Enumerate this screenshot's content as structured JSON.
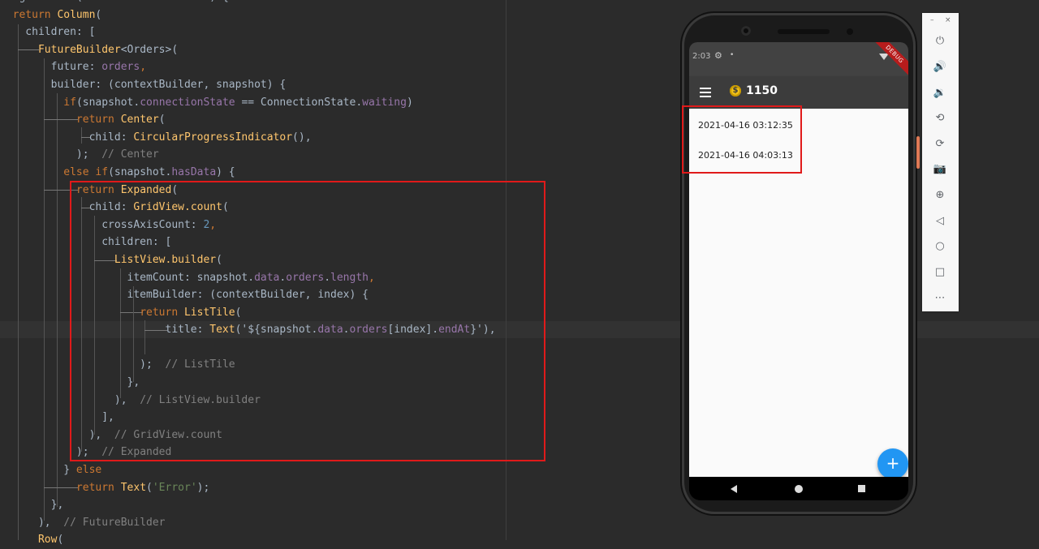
{
  "editor": {
    "lines": [
      [
        {
          "t": "Widget ",
          "c": "plain"
        },
        {
          "t": "build",
          "c": "fn"
        },
        {
          "t": "(BuildContext context) {",
          "c": "plain"
        }
      ],
      [
        {
          "t": "  ",
          "c": "plain"
        },
        {
          "t": "return ",
          "c": "kw"
        },
        {
          "t": "Column",
          "c": "fn"
        },
        {
          "t": "(",
          "c": "plain"
        }
      ],
      [
        {
          "t": "    children: [",
          "c": "plain"
        }
      ],
      [
        {
          "t": "      ",
          "c": "plain"
        },
        {
          "t": "FutureBuilder",
          "c": "fn"
        },
        {
          "t": "<Orders>(",
          "c": "plain"
        }
      ],
      [
        {
          "t": "        future: ",
          "c": "plain"
        },
        {
          "t": "orders",
          "c": "prop"
        },
        {
          "t": ",",
          "c": "kw"
        }
      ],
      [
        {
          "t": "        builder: (contextBuilder, snapshot) {",
          "c": "plain"
        }
      ],
      [
        {
          "t": "          ",
          "c": "plain"
        },
        {
          "t": "if",
          "c": "kw"
        },
        {
          "t": "(snapshot.",
          "c": "plain"
        },
        {
          "t": "connectionState",
          "c": "prop"
        },
        {
          "t": " == ConnectionState.",
          "c": "plain"
        },
        {
          "t": "waiting",
          "c": "prop"
        },
        {
          "t": ")",
          "c": "plain"
        }
      ],
      [
        {
          "t": "            ",
          "c": "plain"
        },
        {
          "t": "return ",
          "c": "kw"
        },
        {
          "t": "Center",
          "c": "fn"
        },
        {
          "t": "(",
          "c": "plain"
        }
      ],
      [
        {
          "t": "              child: ",
          "c": "plain"
        },
        {
          "t": "CircularProgressIndicator",
          "c": "fn"
        },
        {
          "t": "(),",
          "c": "plain"
        }
      ],
      [
        {
          "t": "            );  ",
          "c": "plain"
        },
        {
          "t": "// Center",
          "c": "cm"
        }
      ],
      [
        {
          "t": "          ",
          "c": "plain"
        },
        {
          "t": "else if",
          "c": "kw"
        },
        {
          "t": "(snapshot.",
          "c": "plain"
        },
        {
          "t": "hasData",
          "c": "prop"
        },
        {
          "t": ") {",
          "c": "plain"
        }
      ],
      [
        {
          "t": "            ",
          "c": "plain"
        },
        {
          "t": "return ",
          "c": "kw"
        },
        {
          "t": "Expanded",
          "c": "fn"
        },
        {
          "t": "(",
          "c": "plain"
        }
      ],
      [
        {
          "t": "              child: ",
          "c": "plain"
        },
        {
          "t": "GridView.count",
          "c": "fn"
        },
        {
          "t": "(",
          "c": "plain"
        }
      ],
      [
        {
          "t": "                crossAxisCount: ",
          "c": "plain"
        },
        {
          "t": "2",
          "c": "num"
        },
        {
          "t": ",",
          "c": "kw"
        }
      ],
      [
        {
          "t": "                children: [",
          "c": "plain"
        }
      ],
      [
        {
          "t": "                  ",
          "c": "plain"
        },
        {
          "t": "ListView.builder",
          "c": "fn"
        },
        {
          "t": "(",
          "c": "plain"
        }
      ],
      [
        {
          "t": "                    itemCount: snapshot.",
          "c": "plain"
        },
        {
          "t": "data",
          "c": "prop"
        },
        {
          "t": ".",
          "c": "plain"
        },
        {
          "t": "orders",
          "c": "prop"
        },
        {
          "t": ".",
          "c": "plain"
        },
        {
          "t": "length",
          "c": "prop"
        },
        {
          "t": ",",
          "c": "kw"
        }
      ],
      [
        {
          "t": "                    itemBuilder: (contextBuilder, index) {",
          "c": "plain"
        }
      ],
      [
        {
          "t": "                      ",
          "c": "plain"
        },
        {
          "t": "return ",
          "c": "kw"
        },
        {
          "t": "ListTile",
          "c": "fn"
        },
        {
          "t": "(",
          "c": "plain"
        }
      ],
      [
        {
          "t": "                          title: ",
          "c": "plain"
        },
        {
          "t": "Text",
          "c": "fn"
        },
        {
          "t": "('${snapshot.",
          "c": "plain"
        },
        {
          "t": "data",
          "c": "prop"
        },
        {
          "t": ".",
          "c": "plain"
        },
        {
          "t": "orders",
          "c": "prop"
        },
        {
          "t": "[index].",
          "c": "plain"
        },
        {
          "t": "endAt",
          "c": "prop"
        },
        {
          "t": "}'),",
          "c": "plain"
        }
      ],
      [
        {
          "t": "",
          "c": "plain"
        }
      ],
      [
        {
          "t": "                      );  ",
          "c": "plain"
        },
        {
          "t": "// ListTile",
          "c": "cm"
        }
      ],
      [
        {
          "t": "                    },",
          "c": "plain"
        }
      ],
      [
        {
          "t": "                  ),  ",
          "c": "plain"
        },
        {
          "t": "// ListView.builder",
          "c": "cm"
        }
      ],
      [
        {
          "t": "                ],",
          "c": "plain"
        }
      ],
      [
        {
          "t": "              ),  ",
          "c": "plain"
        },
        {
          "t": "// GridView.count",
          "c": "cm"
        }
      ],
      [
        {
          "t": "            );  ",
          "c": "plain"
        },
        {
          "t": "// Expanded",
          "c": "cm"
        }
      ],
      [
        {
          "t": "          } ",
          "c": "plain"
        },
        {
          "t": "else",
          "c": "kw"
        }
      ],
      [
        {
          "t": "            ",
          "c": "plain"
        },
        {
          "t": "return ",
          "c": "kw"
        },
        {
          "t": "Text",
          "c": "fn"
        },
        {
          "t": "(",
          "c": "plain"
        },
        {
          "t": "'Error'",
          "c": "str"
        },
        {
          "t": ");",
          "c": "plain"
        }
      ],
      [
        {
          "t": "        },",
          "c": "plain"
        }
      ],
      [
        {
          "t": "      ),  ",
          "c": "plain"
        },
        {
          "t": "// FutureBuilder",
          "c": "cm"
        }
      ],
      [
        {
          "t": "      ",
          "c": "plain"
        },
        {
          "t": "Row",
          "c": "fn"
        },
        {
          "t": "(",
          "c": "plain"
        }
      ]
    ]
  },
  "phone": {
    "status_time": "2:03",
    "debug_banner": "DEBUG",
    "coins": "1150",
    "list_items": [
      "2021-04-16 03:12:35",
      "2021-04-16 04:03:13"
    ],
    "fab_label": "+"
  },
  "toolbar": {
    "minimize": "–",
    "close": "×",
    "buttons": [
      {
        "name": "power-icon",
        "glyph": "⏻"
      },
      {
        "name": "volume-up-icon",
        "glyph": "🔊"
      },
      {
        "name": "volume-down-icon",
        "glyph": "🔉"
      },
      {
        "name": "rotate-left-icon",
        "glyph": "⟲"
      },
      {
        "name": "rotate-right-icon",
        "glyph": "⟳"
      },
      {
        "name": "camera-icon",
        "glyph": "📷"
      },
      {
        "name": "zoom-icon",
        "glyph": "⊕"
      },
      {
        "name": "back-icon",
        "glyph": "◁"
      },
      {
        "name": "home-icon",
        "glyph": "○"
      },
      {
        "name": "overview-icon",
        "glyph": "□"
      },
      {
        "name": "more-icon",
        "glyph": "⋯"
      }
    ]
  },
  "colors": {
    "editor_bg": "#2b2b2b",
    "keyword": "#cc7832",
    "function": "#ffc66d",
    "property": "#9876aa",
    "number": "#6897bb",
    "comment": "#808080",
    "highlight": "#e01a1a",
    "fab": "#2196f3"
  }
}
